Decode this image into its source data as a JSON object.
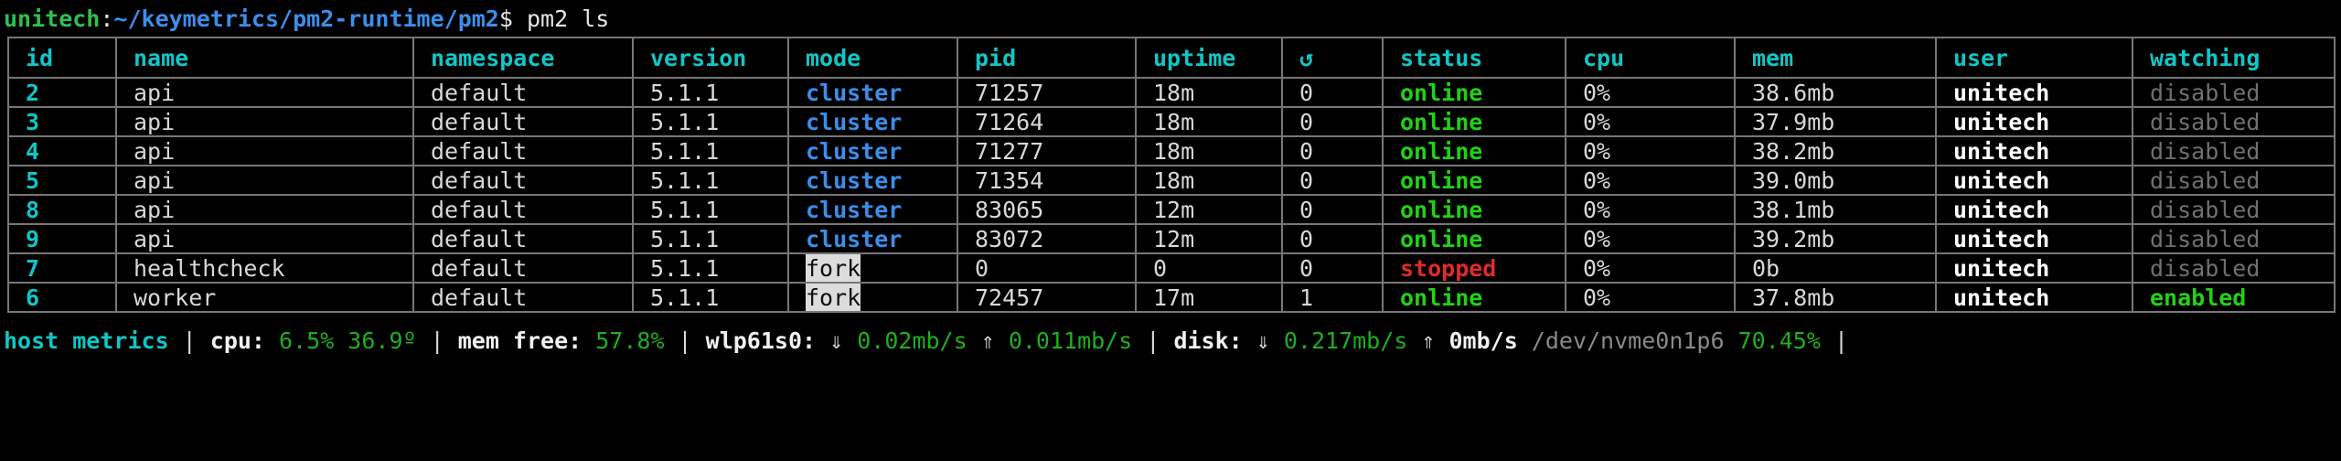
{
  "prompt": {
    "user": "unitech",
    "colon": ":",
    "path": "~/keymetrics/pm2-runtime/pm2",
    "dollar": "$",
    "command": " pm2 ls"
  },
  "table": {
    "headers": {
      "id": "id",
      "name": "name",
      "namespace": "namespace",
      "version": "version",
      "mode": "mode",
      "pid": "pid",
      "uptime": "uptime",
      "restart": "↺",
      "status": "status",
      "cpu": "cpu",
      "mem": "mem",
      "user": "user",
      "watching": "watching"
    },
    "rows": [
      {
        "id": "2",
        "name": "api",
        "namespace": "default",
        "version": "5.1.1",
        "mode": "cluster",
        "pid": "71257",
        "uptime": "18m",
        "restart": "0",
        "status": "online",
        "cpu": "0%",
        "mem": "38.6mb",
        "user": "unitech",
        "watching": "disabled"
      },
      {
        "id": "3",
        "name": "api",
        "namespace": "default",
        "version": "5.1.1",
        "mode": "cluster",
        "pid": "71264",
        "uptime": "18m",
        "restart": "0",
        "status": "online",
        "cpu": "0%",
        "mem": "37.9mb",
        "user": "unitech",
        "watching": "disabled"
      },
      {
        "id": "4",
        "name": "api",
        "namespace": "default",
        "version": "5.1.1",
        "mode": "cluster",
        "pid": "71277",
        "uptime": "18m",
        "restart": "0",
        "status": "online",
        "cpu": "0%",
        "mem": "38.2mb",
        "user": "unitech",
        "watching": "disabled"
      },
      {
        "id": "5",
        "name": "api",
        "namespace": "default",
        "version": "5.1.1",
        "mode": "cluster",
        "pid": "71354",
        "uptime": "18m",
        "restart": "0",
        "status": "online",
        "cpu": "0%",
        "mem": "39.0mb",
        "user": "unitech",
        "watching": "disabled"
      },
      {
        "id": "8",
        "name": "api",
        "namespace": "default",
        "version": "5.1.1",
        "mode": "cluster",
        "pid": "83065",
        "uptime": "12m",
        "restart": "0",
        "status": "online",
        "cpu": "0%",
        "mem": "38.1mb",
        "user": "unitech",
        "watching": "disabled"
      },
      {
        "id": "9",
        "name": "api",
        "namespace": "default",
        "version": "5.1.1",
        "mode": "cluster",
        "pid": "83072",
        "uptime": "12m",
        "restart": "0",
        "status": "online",
        "cpu": "0%",
        "mem": "39.2mb",
        "user": "unitech",
        "watching": "disabled"
      },
      {
        "id": "7",
        "name": "healthcheck",
        "namespace": "default",
        "version": "5.1.1",
        "mode": "fork",
        "pid": "0",
        "uptime": "0",
        "restart": "0",
        "status": "stopped",
        "cpu": "0%",
        "mem": "0b",
        "user": "unitech",
        "watching": "disabled"
      },
      {
        "id": "6",
        "name": "worker",
        "namespace": "default",
        "version": "5.1.1",
        "mode": "fork",
        "pid": "72457",
        "uptime": "17m",
        "restart": "1",
        "status": "online",
        "cpu": "0%",
        "mem": "37.8mb",
        "user": "unitech",
        "watching": "enabled"
      }
    ]
  },
  "host_metrics": {
    "title": "host metrics",
    "sep": " | ",
    "cpu_label": "cpu: ",
    "cpu_value": "6.5% 36.9º",
    "mem_label": "mem free: ",
    "mem_value": "57.8%",
    "net_label": "wlp61s0: ",
    "net_down_arrow": "⇓ ",
    "net_down_value": "0.02mb/s",
    "net_up_arrow": " ⇑ ",
    "net_up_value": "0.011mb/s",
    "disk_label": "disk: ",
    "disk_down_arrow": "⇓ ",
    "disk_down_value": "0.217mb/s",
    "disk_up_arrow": " ⇑ ",
    "disk_up_value": "0mb/s",
    "disk_device": " /dev/nvme0n1p6 ",
    "disk_usage": "70.45%",
    "tail": " |"
  },
  "colors": {
    "background": "#000000",
    "header_cyan": "#11c6c6",
    "green": "#23d018",
    "red": "#e02b2b",
    "blue": "#3b8eea",
    "prompt_green": "#2fbf4f",
    "dim_gray": "#707070",
    "metric_green": "#1fae1f",
    "border_gray": "#777777"
  }
}
